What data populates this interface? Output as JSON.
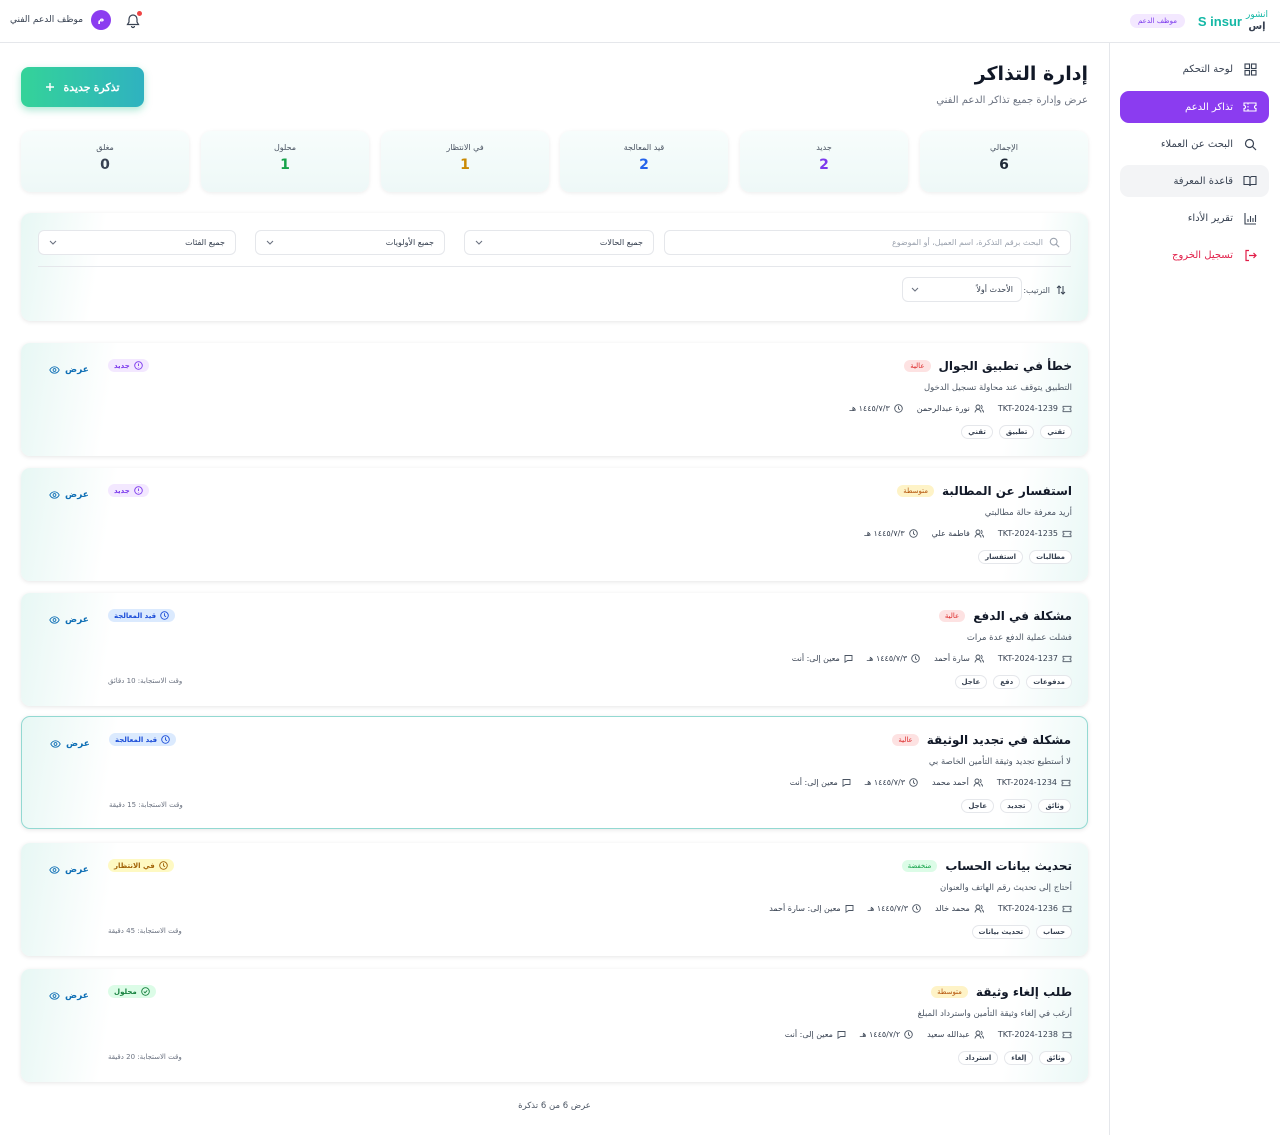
{
  "header": {
    "logo_text": "S insur",
    "logo_arabic_top": "انشور",
    "logo_arabic_bottom": "إس",
    "role_badge": "موظف الدعم",
    "user_name": "موظف الدعم الفني",
    "avatar_initial": "م"
  },
  "sidebar": {
    "items": [
      {
        "label": "لوحة التحكم",
        "icon": "grid-icon"
      },
      {
        "label": "تذاكر الدعم",
        "icon": "ticket-icon"
      },
      {
        "label": "البحث عن العملاء",
        "icon": "search-icon"
      },
      {
        "label": "قاعدة المعرفة",
        "icon": "book-icon"
      },
      {
        "label": "تقرير الأداء",
        "icon": "chart-icon"
      },
      {
        "label": "تسجيل الخروج",
        "icon": "logout-icon"
      }
    ]
  },
  "page": {
    "title": "إدارة التذاكر",
    "subtitle": "عرض وإدارة جميع تذاكر الدعم الفني",
    "new_ticket": "تذكرة جديدة"
  },
  "stats": [
    {
      "label": "الإجمالي",
      "value": "6",
      "color": "#1f2937"
    },
    {
      "label": "جديد",
      "value": "2",
      "color": "#7c3aed"
    },
    {
      "label": "قيد المعالجة",
      "value": "2",
      "color": "#2563eb"
    },
    {
      "label": "في الانتظار",
      "value": "1",
      "color": "#ca8a04"
    },
    {
      "label": "محلول",
      "value": "1",
      "color": "#16a34a"
    },
    {
      "label": "مغلق",
      "value": "0",
      "color": "#374151"
    }
  ],
  "filters": {
    "search_placeholder": "البحث برقم التذكرة، اسم العميل، أو الموضوع",
    "status": "جميع الحالات",
    "priority": "جميع الأولويات",
    "category": "جميع الفئات",
    "sort_label": "الترتيب:",
    "sort_value": "الأحدث أولاً"
  },
  "tickets": [
    {
      "title": "خطأ في تطبيق الجوال",
      "priority": "عالية",
      "desc": "التطبيق يتوقف عند محاولة تسجيل الدخول",
      "id": "TKT-2024-1239",
      "customer": "نورة عبدالرحمن",
      "date": "١٤٤٥/٧/٣ هـ",
      "assigned": "",
      "tags": [
        "تقني",
        "تطبيق",
        "تقني"
      ],
      "status": "جديد",
      "view": "عرض",
      "resp": ""
    },
    {
      "title": "استفسار عن المطالبة",
      "priority": "متوسطة",
      "desc": "أريد معرفة حالة مطالبتي",
      "id": "TKT-2024-1235",
      "customer": "فاطمة علي",
      "date": "١٤٤٥/٧/٣ هـ",
      "assigned": "",
      "tags": [
        "مطالبات",
        "استفسار"
      ],
      "status": "جديد",
      "view": "عرض",
      "resp": ""
    },
    {
      "title": "مشكلة في الدفع",
      "priority": "عالية",
      "desc": "فشلت عملية الدفع عدة مرات",
      "id": "TKT-2024-1237",
      "customer": "سارة أحمد",
      "date": "١٤٤٥/٧/٣ هـ",
      "assigned": "معين إلى: أنت",
      "tags": [
        "مدفوعات",
        "دفع",
        "عاجل"
      ],
      "status": "قيد المعالجة",
      "view": "عرض",
      "resp": "وقت الاستجابة: 10 دقائق"
    },
    {
      "title": "مشكلة في تجديد الوثيقة",
      "priority": "عالية",
      "desc": "لا أستطيع تجديد وثيقة التأمين الخاصة بي",
      "id": "TKT-2024-1234",
      "customer": "أحمد محمد",
      "date": "١٤٤٥/٧/٣ هـ",
      "assigned": "معين إلى: أنت",
      "tags": [
        "وثائق",
        "تجديد",
        "عاجل"
      ],
      "status": "قيد المعالجة",
      "view": "عرض",
      "resp": "وقت الاستجابة: 15 دقيقة"
    },
    {
      "title": "تحديث بيانات الحساب",
      "priority": "منخفضة",
      "desc": "أحتاج إلى تحديث رقم الهاتف والعنوان",
      "id": "TKT-2024-1236",
      "customer": "محمد خالد",
      "date": "١٤٤٥/٧/٣ هـ",
      "assigned": "معين إلى: سارة أحمد",
      "tags": [
        "حساب",
        "تحديث بيانات"
      ],
      "status": "في الانتظار",
      "view": "عرض",
      "resp": "وقت الاستجابة: 45 دقيقة"
    },
    {
      "title": "طلب إلغاء وثيقة",
      "priority": "متوسطة",
      "desc": "أرغب في إلغاء وثيقة التأمين واسترداد المبلغ",
      "id": "TKT-2024-1238",
      "customer": "عبدالله سعيد",
      "date": "١٤٤٥/٧/٢ هـ",
      "assigned": "معين إلى: أنت",
      "tags": [
        "وثائق",
        "إلغاء",
        "استرداد"
      ],
      "status": "محلول",
      "view": "عرض",
      "resp": "وقت الاستجابة: 20 دقيقة"
    }
  ],
  "footer": "عرض 6 من 6 تذكرة"
}
